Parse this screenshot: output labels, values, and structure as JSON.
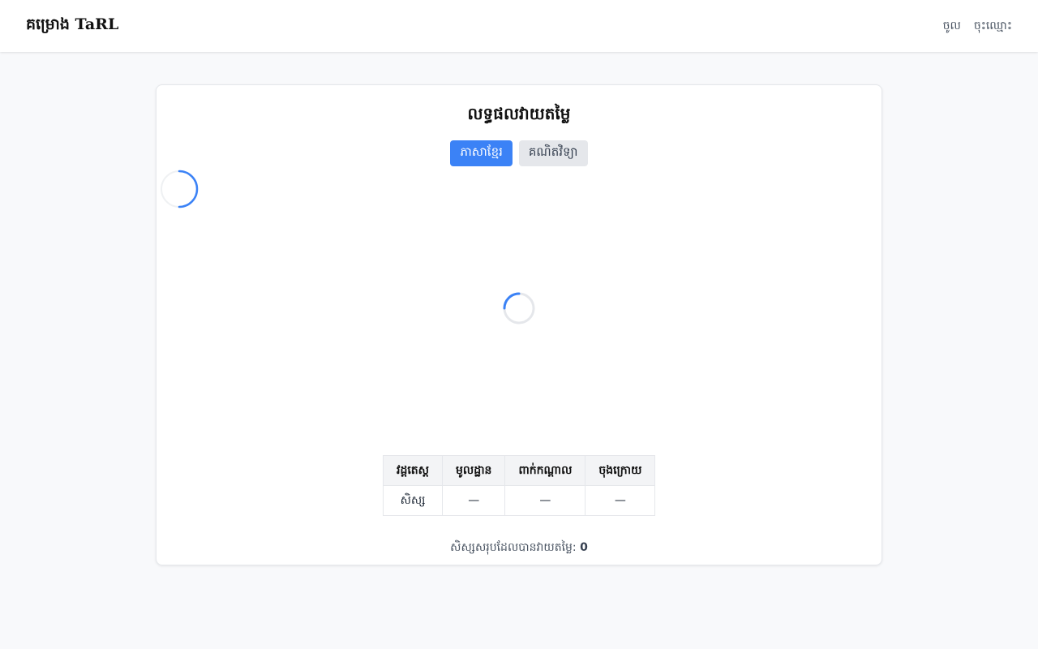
{
  "header": {
    "brand": "គម្រោង TaRL",
    "nav": {
      "login": "ចូល",
      "register": "ចុះឈ្មោះ"
    }
  },
  "main": {
    "title": "លទ្ធផលវាយតម្លៃ",
    "tabs": [
      {
        "label": "ភាសាខ្មែរ",
        "active": true
      },
      {
        "label": "គណិតវិទ្យា",
        "active": false
      }
    ],
    "table": {
      "headers": [
        "វដ្តតេស្ត",
        "មូលដ្ឋាន",
        "ពាក់កណ្តាល",
        "ចុងក្រោយ"
      ],
      "rows": [
        [
          "សិស្ស",
          "—",
          "—",
          "—"
        ]
      ]
    },
    "total": {
      "label": "សិស្សសរុបដែលបានវាយតម្លៃ:",
      "value": "0"
    }
  },
  "colors": {
    "accent": "#3b82f6",
    "inactive_tab": "#e5e7eb",
    "background": "#f8f9fb"
  },
  "icons": {
    "loading_small": "loading-spinner-icon",
    "loading_center": "loading-spinner-icon"
  }
}
